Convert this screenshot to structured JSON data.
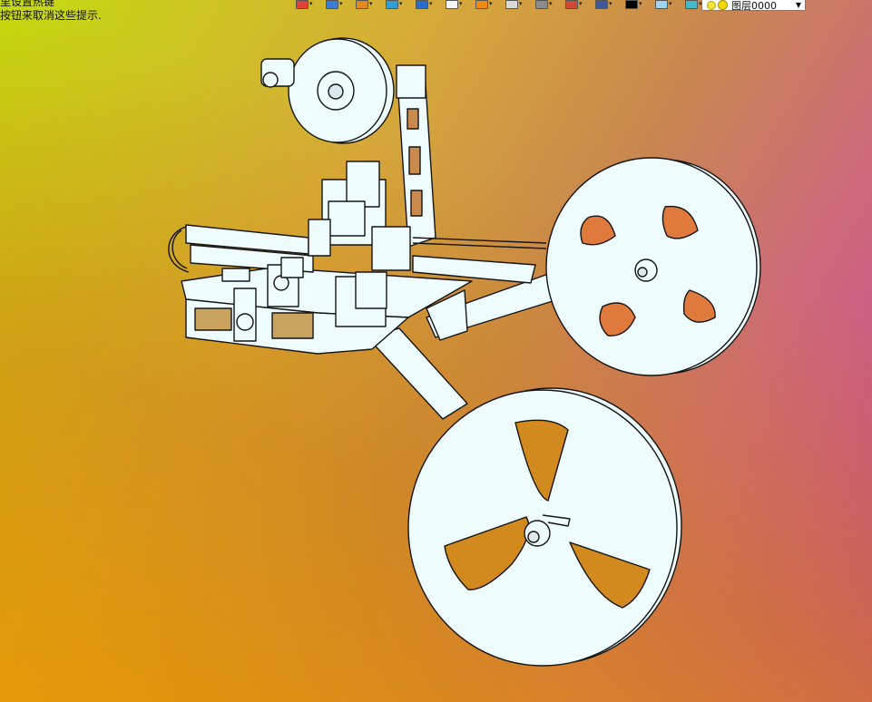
{
  "hints": {
    "line1": "里设置热键",
    "line2": "按钮来取消这些提示."
  },
  "toolbar": {
    "buttons": [
      {
        "name": "layer-state-icon",
        "color": "#e2413b"
      },
      {
        "name": "view-orient-icon",
        "color": "#3a7bd5"
      },
      {
        "name": "pencil-icon",
        "color": "#e08a1e"
      },
      {
        "name": "cube-shaded-icon",
        "color": "#2f9fd8"
      },
      {
        "name": "cube-blue-icon",
        "color": "#2a6fd0"
      },
      {
        "name": "cube-white-icon",
        "color": "#f4f4f4"
      },
      {
        "name": "render-icon",
        "color": "#f08a12"
      },
      {
        "name": "section-view-icon",
        "color": "#d9d9d9"
      },
      {
        "name": "camera-icon",
        "color": "#8c8c8c"
      },
      {
        "name": "display-style-icon",
        "color": "#d04a3a"
      },
      {
        "name": "monitor-icon",
        "color": "#3c5a9a"
      },
      {
        "name": "black-square-icon",
        "color": "#000000"
      },
      {
        "name": "sheet-icon",
        "color": "#9fd4f0"
      },
      {
        "name": "stack-icon",
        "color": "#45b8c9"
      }
    ],
    "layer_label": "图层0000"
  },
  "colors": {
    "part_fill": "#eefcfe",
    "outline": "#141414",
    "cutout": "#e07a3c"
  }
}
